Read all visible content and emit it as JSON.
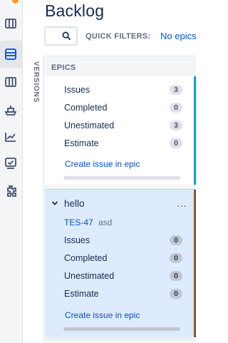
{
  "app": {
    "page_title": "Backlog"
  },
  "header": {
    "quick_filters_label": "QUICK FILTERS:",
    "quick_filter_value": "No epics"
  },
  "versions_tab": "VERSIONS",
  "epics_panel": {
    "title": "EPICS",
    "unnamed_epic": {
      "stats": [
        {
          "label": "Issues",
          "value": "3"
        },
        {
          "label": "Completed",
          "value": "0"
        },
        {
          "label": "Unestimated",
          "value": "3"
        },
        {
          "label": "Estimate",
          "value": "0"
        }
      ],
      "create_link": "Create issue in epic",
      "accent_color": "#00a3bf"
    },
    "hello_epic": {
      "name": "hello",
      "more_label": "...",
      "key": "TES-47",
      "summary": "asd",
      "stats": [
        {
          "label": "Issues",
          "value": "0"
        },
        {
          "label": "Completed",
          "value": "0"
        },
        {
          "label": "Unestimated",
          "value": "0"
        },
        {
          "label": "Estimate",
          "value": "0"
        }
      ],
      "create_link": "Create issue in epic",
      "accent_color": "#8b572a"
    }
  },
  "colors": {
    "link": "#0052cc",
    "selected_bg": "#deebff",
    "notification": "#ff991f"
  },
  "rail_icons": [
    "roadmap-icon",
    "backlog-icon",
    "board-icon",
    "releases-icon",
    "reports-icon",
    "issues-icon",
    "add-ons-icon"
  ]
}
